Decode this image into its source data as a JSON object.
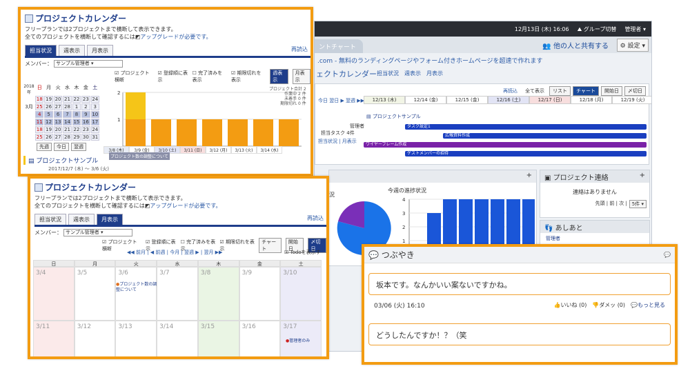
{
  "bg": {
    "datetime": "12月13日 (木) 16:06",
    "group_switch": "グループ切替",
    "admin": "管理者",
    "gantt_tab": "ントチャート",
    "share": "他の人と共有する",
    "settings": "設定",
    "info": ".com - 無料のランディングページやフォーム付きホームページを超速で作れます",
    "pc_title": "ェクトカレンダー",
    "views": [
      "担当状況",
      "週表示",
      "月表示"
    ],
    "reload": "再読込",
    "all_show": "全て表示",
    "list": "リスト",
    "chart": "チャート",
    "start_day": "開始日",
    "deadline": "〆切日",
    "nav": "今日 翌日 ▶ 翌週 ▶▶",
    "dates": [
      "12/13 (木)",
      "12/14 (金)",
      "12/15 (金)",
      "12/16 (土)",
      "12/17 (日)",
      "12/18 (月)",
      "12/19 (火)"
    ],
    "project": "プロジェクトサンプル",
    "manager": "管理者",
    "tasks": "担当タスク",
    "task_count": "4件",
    "status_links": "担当状況 | 月表示",
    "bars": [
      "タスク設定1",
      "広報資料作成",
      "ワイヤーフレーム作成",
      "ゲストメンバーの招待"
    ],
    "progress_title": "今週の進捗状況",
    "progress_ticks": [
      "4",
      "3",
      "2",
      "1",
      "0"
    ],
    "progress_values": [
      0,
      3,
      4,
      4,
      4,
      4,
      4,
      4
    ],
    "contact_title": "プロジェクト連絡",
    "contact_empty": "連絡はありません",
    "contact_nav": "先頭 | 前 | 次 |",
    "contact_per": "5件",
    "ashiato": "あしあと",
    "ashiato_user": "管理者",
    "left_label": "況"
  },
  "card1": {
    "title": "プロジェクトカレンダー",
    "note1": "フリープランでは2プロジェクトまで横断して表示できます。",
    "note2": "全てのプロジェクトを横断して確認するには",
    "upgrade": "アップグレードが必要です。",
    "tabs": [
      "担当状況",
      "週表示",
      "月表示"
    ],
    "reload": "再読込",
    "member_label": "メンバー：",
    "member_value": "サンプル管理者",
    "checks": [
      "プロジェクト横断",
      "登録順に表示",
      "完了済みを表示",
      "期限切れを表示"
    ],
    "btn_week": "週表示",
    "btn_month": "月表示",
    "cal_year": "2018年",
    "cal_month": "3月",
    "cal_dow": [
      "日",
      "月",
      "火",
      "水",
      "木",
      "金",
      "土"
    ],
    "cal_rows": [
      [
        "18",
        "19",
        "20",
        "21",
        "22",
        "23",
        "24"
      ],
      [
        "25",
        "26",
        "27",
        "28",
        "1",
        "2",
        "3"
      ],
      [
        "4",
        "5",
        "6",
        "7",
        "8",
        "9",
        "10"
      ],
      [
        "11",
        "12",
        "13",
        "14",
        "15",
        "16",
        "17"
      ],
      [
        "18",
        "19",
        "20",
        "21",
        "22",
        "23",
        "24"
      ],
      [
        "25",
        "26",
        "27",
        "28",
        "29",
        "30",
        "31"
      ]
    ],
    "cal_btns": [
      "先週",
      "今日",
      "翌週"
    ],
    "chart_legend": [
      "プロジェクト合計 2",
      "作業中 2 件",
      "未着手 0 件",
      "期限切れ 0 件"
    ],
    "chart_dates": [
      "3/8 (木)",
      "3/9 (金)",
      "3/10 (土)",
      "3/11 (日)",
      "3/12 (月)",
      "3/13 (火)",
      "3/14 (水)"
    ],
    "project": "プロジェクトサンプル",
    "task": "プロジェクト数の調整について",
    "period": "2017/12/7 (木) ～ 3/6 (火)"
  },
  "card2": {
    "title": "プロジェクトカレンダー",
    "note1": "フリープランでは2プロジェクトまで横断して表示できます。",
    "note2": "全てのプロジェクトを横断して確認するには",
    "upgrade": "アップグレードが必要です。",
    "tabs": [
      "担当状況",
      "週表示",
      "月表示"
    ],
    "reload": "再読込",
    "member_label": "メンバー：",
    "member_value": "サンプル管理者",
    "checks": [
      "プロジェクト横断",
      "登録順に表示",
      "完了済みを表示",
      "期限切れを表示"
    ],
    "btn_chart": "チャート",
    "btn_start": "開始日",
    "btn_deadline": "〆切日",
    "nav": "◀◀ 前月 | ◀ 前週 | 今月 | 翌週 ▶ | 翌月 ▶▶",
    "todo": "Todoを表示す",
    "dow": [
      "日",
      "月",
      "火",
      "水",
      "木",
      "金",
      "土"
    ],
    "week1": [
      "3/4",
      "3/5",
      "3/6",
      "3/7",
      "3/8",
      "3/9",
      "3/10"
    ],
    "week2": [
      "3/11",
      "3/12",
      "3/13",
      "3/14",
      "3/15",
      "3/16",
      "3/17"
    ],
    "event": "プロジェクト数の調整について",
    "event2": "管理者のみ"
  },
  "tsubuyaki": {
    "title": "つぶやき",
    "post1": "坂本です。なんかいい案ないですかね。",
    "time1": "03/06 (火) 16:10",
    "like": "いいね",
    "like_count": "(0)",
    "dame": "ダメッ",
    "dame_count": "(0)",
    "more": "もっと見る",
    "post2": "どうしたんですか！？（笑"
  }
}
